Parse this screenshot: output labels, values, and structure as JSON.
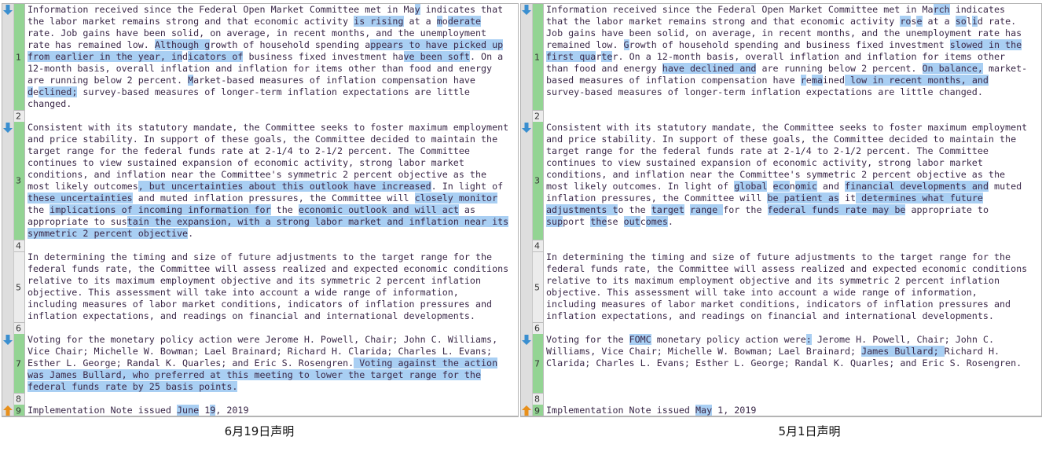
{
  "colors": {
    "changed": "#93d493",
    "highlight": "#a9cff3",
    "arrow_down": "#3a8fd0",
    "arrow_up": "#e8901c"
  },
  "left": {
    "caption": "6月19日声明",
    "blocks": [
      {
        "num": "1",
        "changed": true,
        "arrow": "arrow-down",
        "lines": [
          [
            "Information received since the Federal Open Market Committee met in Ma",
            "y",
            " indicates that"
          ],
          [
            "the labor market remains strong and that economic activity ",
            "is rising",
            " at a ",
            "m",
            "o",
            "derate"
          ],
          [
            "rate. Job gains have been solid, on average, in recent months, and the unemployment"
          ],
          [
            "rate has remained low. ",
            "Although g",
            "rowth of household spending a",
            "ppears to have picked up"
          ],
          [
            "",
            "from earlier in the year, in",
            "d",
            "icators of",
            " business fixed investment ha",
            "ve been soft",
            ". On a"
          ],
          [
            "12-month basis, overall inflation and inflation for items other than food and energy"
          ],
          [
            "are running below 2 percent. ",
            "M",
            "arket-based measures of inflation compensation have"
          ],
          [
            "",
            "d",
            "e",
            "clined;",
            " survey-based measures of longer-term inflation expectations are little"
          ],
          [
            "changed."
          ]
        ]
      },
      {
        "num": "2",
        "changed": false,
        "lines": [
          [
            ""
          ]
        ]
      },
      {
        "num": "3",
        "changed": true,
        "arrow": "arrow-down",
        "lines": [
          [
            "Consistent with its statutory mandate, the Committee seeks to foster maximum employment"
          ],
          [
            "and price stability. In support of these goals, the Committee decided to maintain the"
          ],
          [
            "target range for the federal funds rate at 2-1/4 to 2-1/2 percent. The Committee"
          ],
          [
            "continues to view sustained expansion of economic activity, strong labor market"
          ],
          [
            "conditions, and inflation near the Committee's symmetric 2 percent objective as the"
          ],
          [
            "most likely outcomes",
            ", but uncertainties about this outlook have increased",
            ". In light of"
          ],
          [
            "",
            "these uncertainties",
            " and muted inflation pressures, the Committee will ",
            "closely monitor"
          ],
          [
            "the ",
            "implications of incoming information for",
            " the ",
            "economic outlook and will act",
            " as"
          ],
          [
            "appropriate to sus",
            "tain the expansion, with a strong labor market and inflation near its"
          ],
          [
            "",
            "symmetric 2 percent objective",
            "."
          ]
        ]
      },
      {
        "num": "4",
        "changed": false,
        "lines": [
          [
            ""
          ]
        ]
      },
      {
        "num": "5",
        "changed": false,
        "lines": [
          [
            "In determining the timing and size of future adjustments to the target range for the"
          ],
          [
            "federal funds rate, the Committee will assess realized and expected economic conditions"
          ],
          [
            "relative to its maximum employment objective and its symmetric 2 percent inflation"
          ],
          [
            "objective. This assessment will take into account a wide range of information,"
          ],
          [
            "including measures of labor market conditions, indicators of inflation pressures and"
          ],
          [
            "inflation expectations, and readings on financial and international developments."
          ]
        ]
      },
      {
        "num": "6",
        "changed": false,
        "lines": [
          [
            ""
          ]
        ]
      },
      {
        "num": "7",
        "changed": true,
        "arrow": "arrow-down",
        "lines": [
          [
            "Voting for the monetary policy action were Jerome H. Powell, Chair; John C. Williams,"
          ],
          [
            "Vice Chair; Michelle W. Bowman; Lael Brainard; Richard H. Clarida; Charles L. Evans;"
          ],
          [
            "Esther L. George; Randal K. Quarles; and Eric S. Rosengren.",
            " Voting against the action"
          ],
          [
            "",
            "was James Bullard, who preferred at this meeting to lower the target range for the"
          ],
          [
            "",
            "federal funds rate by 25 basis points."
          ]
        ]
      },
      {
        "num": "8",
        "changed": false,
        "lines": [
          [
            ""
          ]
        ]
      },
      {
        "num": "9",
        "changed": true,
        "arrow": "arrow-up",
        "lines": [
          [
            "Implementation Note issued ",
            "June",
            " 1",
            "9",
            ", 2019"
          ]
        ]
      }
    ]
  },
  "right": {
    "caption": "5月1日声明",
    "blocks": [
      {
        "num": "1",
        "changed": true,
        "arrow": "arrow-down",
        "lines": [
          [
            "Information received since the Federal Open Market Committee met in Ma",
            "rch",
            " indicates"
          ],
          [
            "that the labor market remains strong and that economic activity ",
            "ro",
            "s",
            "e",
            " at a ",
            "so",
            "l",
            "i",
            "d rate."
          ],
          [
            "Job gains have been solid, on average, in recent months, and the unemployment rate has"
          ],
          [
            "remained low. ",
            "G",
            "rowth of household spending and business fixed investment ",
            "slowed in the"
          ],
          [
            "",
            "first qua",
            "r",
            "te",
            "r. On a 12-month basis, overall inflation and inflation for items other"
          ],
          [
            "than food and energy ",
            "have declined and",
            " are running below 2 percent. ",
            "On balance,",
            " market-"
          ],
          [
            "based measures of inflation compensation have ",
            "r",
            "e",
            "ma",
            "ined",
            " low in recent months, and"
          ],
          [
            "survey-based measures of longer-term inflation expectations are little changed."
          ]
        ]
      },
      {
        "num": "2",
        "changed": false,
        "lines": [
          [
            ""
          ]
        ]
      },
      {
        "num": "3",
        "changed": true,
        "arrow": "arrow-down",
        "lines": [
          [
            "Consistent with its statutory mandate, the Committee seeks to foster maximum employment"
          ],
          [
            "and price stability. In support of these goals, the Committee decided to maintain the"
          ],
          [
            "target range for the federal funds rate at 2-1/4 to 2-1/2 percent. The Committee"
          ],
          [
            "continues to view sustained expansion of economic activity, strong labor market"
          ],
          [
            "conditions, and inflation near the Committee's symmetric 2 percent objective as the"
          ],
          [
            "most likely outcomes. In light of ",
            "global",
            " ",
            "eco",
            "n",
            "omic",
            " and ",
            "financial developments and",
            " muted"
          ],
          [
            "inflation pressures, the Committee will ",
            "be patient as",
            " it",
            " determines what future"
          ],
          [
            "",
            "adjustments t",
            "o the ",
            "target",
            " ",
            "range ",
            "for the ",
            "federal funds rate may be",
            " appropriate to"
          ],
          [
            "",
            "sup",
            "port ",
            "the",
            "se ",
            "out",
            "c",
            "omes",
            "."
          ]
        ]
      },
      {
        "num": "4",
        "changed": false,
        "lines": [
          [
            ""
          ]
        ]
      },
      {
        "num": "5",
        "changed": false,
        "lines": [
          [
            "In determining the timing and size of future adjustments to the target range for the"
          ],
          [
            "federal funds rate, the Committee will assess realized and expected economic conditions"
          ],
          [
            "relative to its maximum employment objective and its symmetric 2 percent inflation"
          ],
          [
            "objective. This assessment will take into account a wide range of information,"
          ],
          [
            "including measures of labor market conditions, indicators of inflation pressures and"
          ],
          [
            "inflation expectations, and readings on financial and international developments."
          ]
        ]
      },
      {
        "num": "6",
        "changed": false,
        "lines": [
          [
            ""
          ]
        ]
      },
      {
        "num": "7",
        "changed": true,
        "arrow": "arrow-down",
        "lines": [
          [
            "Voting for the ",
            "FOMC",
            " monetary policy action were",
            ":",
            " Jerome H. Powell, Chair; John C."
          ],
          [
            "Williams, Vice Chair; Michelle W. Bowman; Lael Brainard; ",
            "James Bullard; ",
            "Richard H."
          ],
          [
            "Clarida; Charles L. Evans; Esther L. George; Randal K. Quarles; and Eric S. Rosengren."
          ]
        ]
      },
      {
        "num": "8",
        "changed": false,
        "lines": [
          [
            ""
          ]
        ]
      },
      {
        "num": "9",
        "changed": true,
        "arrow": "arrow-up",
        "lines": [
          [
            "Implementation Note issued ",
            "May",
            " 1, 2019"
          ]
        ]
      }
    ]
  }
}
